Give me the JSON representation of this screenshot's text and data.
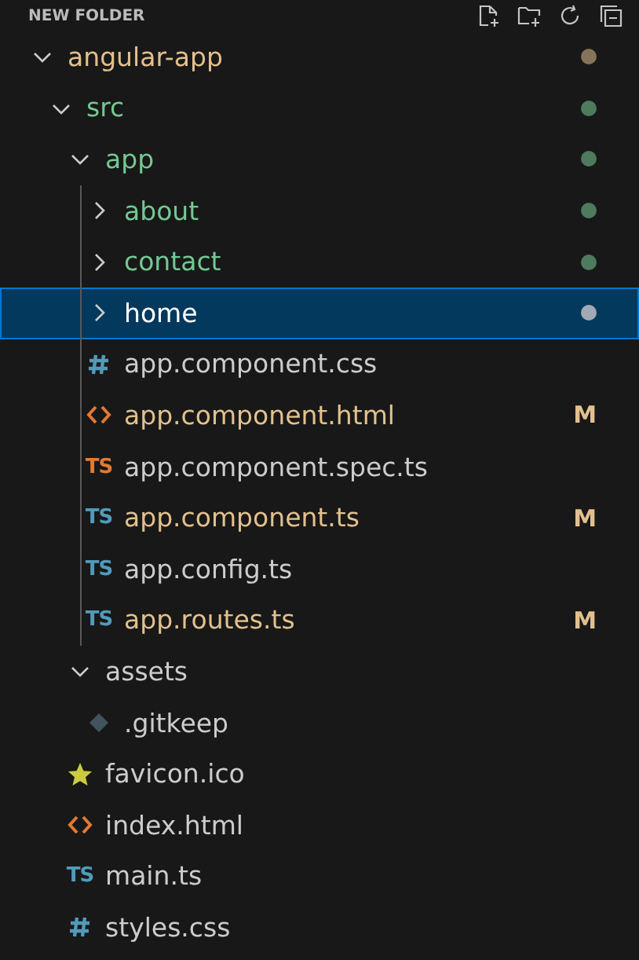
{
  "header": {
    "title": "NEW FOLDER"
  },
  "tree": [
    {
      "name": "angular-app",
      "kind": "folder",
      "expanded": true,
      "selected": false,
      "modified": true,
      "dot": {
        "color": "#857459"
      },
      "children": [
        {
          "name": "src",
          "kind": "folder",
          "expanded": true,
          "selected": false,
          "untracked": true,
          "dot": {
            "color": "#4e7a5e"
          },
          "children": [
            {
              "name": "app",
              "kind": "folder",
              "expanded": true,
              "selected": false,
              "untracked": true,
              "dot": {
                "color": "#4e7a5e"
              },
              "children": [
                {
                  "name": "about",
                  "kind": "folder",
                  "expanded": false,
                  "selected": false,
                  "untracked": true,
                  "dot": {
                    "color": "#4e7a5e"
                  }
                },
                {
                  "name": "contact",
                  "kind": "folder",
                  "expanded": false,
                  "selected": false,
                  "untracked": true,
                  "dot": {
                    "color": "#4e7a5e"
                  }
                },
                {
                  "name": "home",
                  "kind": "folder",
                  "expanded": false,
                  "selected": true,
                  "dot": {
                    "color": "#a0aab5"
                  }
                },
                {
                  "name": "app.component.css",
                  "kind": "css",
                  "selected": false,
                  "modified": false,
                  "untracked": false
                },
                {
                  "name": "app.component.html",
                  "kind": "html",
                  "selected": false,
                  "modified": true,
                  "badge": "M"
                },
                {
                  "name": "app.component.spec.ts",
                  "kind": "spec",
                  "icon": "TS",
                  "selected": false,
                  "modified": false,
                  "untracked": false
                },
                {
                  "name": "app.component.ts",
                  "kind": "ts",
                  "icon": "TS",
                  "selected": false,
                  "modified": true,
                  "badge": "M"
                },
                {
                  "name": "app.config.ts",
                  "kind": "ts",
                  "icon": "TS",
                  "selected": false,
                  "modified": false,
                  "untracked": false
                },
                {
                  "name": "app.routes.ts",
                  "kind": "ts",
                  "icon": "TS",
                  "selected": false,
                  "modified": true,
                  "badge": "M"
                }
              ]
            },
            {
              "name": "assets",
              "kind": "folder",
              "expanded": true,
              "selected": false,
              "modified": false,
              "untracked": false,
              "children": [
                {
                  "name": ".gitkeep",
                  "kind": "git",
                  "selected": false,
                  "modified": false,
                  "untracked": false
                }
              ]
            },
            {
              "name": "favicon.ico",
              "kind": "ico",
              "selected": false,
              "modified": false,
              "untracked": false
            },
            {
              "name": "index.html",
              "kind": "html",
              "selected": false,
              "modified": false,
              "untracked": false
            },
            {
              "name": "main.ts",
              "kind": "ts",
              "icon": "TS",
              "selected": false,
              "modified": false,
              "untracked": false
            },
            {
              "name": "styles.css",
              "kind": "css",
              "selected": false,
              "modified": false,
              "untracked": false
            }
          ]
        }
      ]
    }
  ]
}
